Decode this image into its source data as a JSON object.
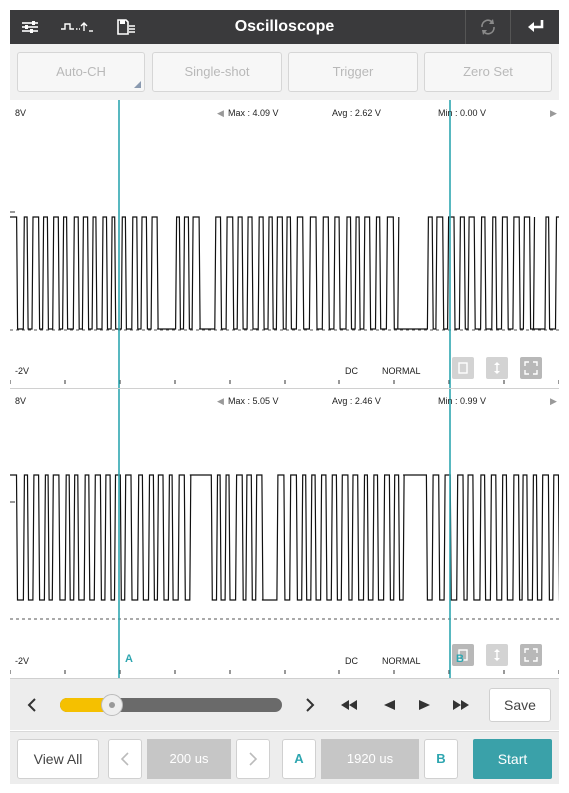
{
  "header": {
    "title": "Oscilloscope",
    "icons": [
      "settings-sliders-icon",
      "signal-probe-icon",
      "save-file-icon",
      "refresh-icon",
      "back-arrow-icon"
    ]
  },
  "toolbar": {
    "auto_ch": "Auto-CH",
    "single_shot": "Single-shot",
    "trigger": "Trigger",
    "zero_set": "Zero Set"
  },
  "channels": [
    {
      "top_label": "8V",
      "bottom_label": "-2V",
      "max": "Max : 4.09 V",
      "avg": "Avg : 2.62 V",
      "min": "Min : 0.00 V",
      "coupling": "DC",
      "mode": "NORMAL"
    },
    {
      "top_label": "8V",
      "bottom_label": "-2V",
      "max": "Max : 5.05 V",
      "avg": "Avg : 2.46 V",
      "min": "Min : 0.99 V",
      "coupling": "DC",
      "mode": "NORMAL"
    }
  ],
  "cursors": {
    "a_label": "A",
    "b_label": "B",
    "color": "#2ea6b0"
  },
  "playback": {
    "save": "Save",
    "slider_fraction": 0.2
  },
  "bottom": {
    "view_all": "View All",
    "timebase": "200 us",
    "cursor_a": "A",
    "cursor_delta": "1920 us",
    "cursor_b": "B",
    "start": "Start"
  },
  "colors": {
    "accent": "#3aa1a9",
    "slider_fill": "#f5c000",
    "titlebar": "#3a3a3c"
  }
}
